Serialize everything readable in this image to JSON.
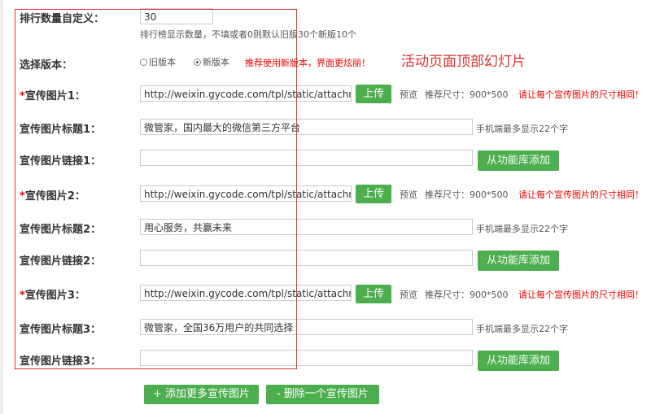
{
  "count_field": {
    "label": "排行数量自定义：",
    "value": "30",
    "hint": "排行榜显示数量，不填或者0则默认旧版30个新版10个"
  },
  "version_field": {
    "label": "选择版本：",
    "old_option": "旧版本",
    "new_option": "新版本",
    "selected": "new",
    "recommend_note": "推荐使用新版本，界面更炫丽！"
  },
  "annotation": "活动页面顶部幻灯片",
  "slides": [
    {
      "image_label": "宣传图片1：",
      "image_url": "http://weixin.gycode.com/tpl/static/attachm",
      "title_label": "宣传图片标题1：",
      "title_value": "微管家，国内最大的微信第三方平台",
      "link_label": "宣传图片链接1：",
      "link_value": ""
    },
    {
      "image_label": "宣传图片2：",
      "image_url": "http://weixin.gycode.com/tpl/static/attachm",
      "title_label": "宣传图片标题2：",
      "title_value": "用心服务，共赢未来",
      "link_label": "宣传图片链接2：",
      "link_value": ""
    },
    {
      "image_label": "宣传图片3：",
      "image_url": "http://weixin.gycode.com/tpl/static/attachm",
      "title_label": "宣传图片标题3：",
      "title_value": "微管家，全国36万用户的共同选择",
      "link_label": "宣传图片链接3：",
      "link_value": ""
    }
  ],
  "common": {
    "required_mark": "*",
    "upload_button": "上传",
    "preview_link": "预览",
    "size_hint": "推荐尺寸：900*500",
    "size_warning": "请让每个宣传图片的尺寸相同！",
    "title_hint": "手机端最多显示22个字",
    "add_from_library_button": "从功能库添加"
  },
  "footer": {
    "add_more_button": "+ 添加更多宣传图片",
    "delete_one_button": "- 删除一个宣传图片"
  },
  "colors": {
    "accent_green": "#4cae4c",
    "warning_red": "#e00000",
    "annotation_box": "#d33333"
  }
}
